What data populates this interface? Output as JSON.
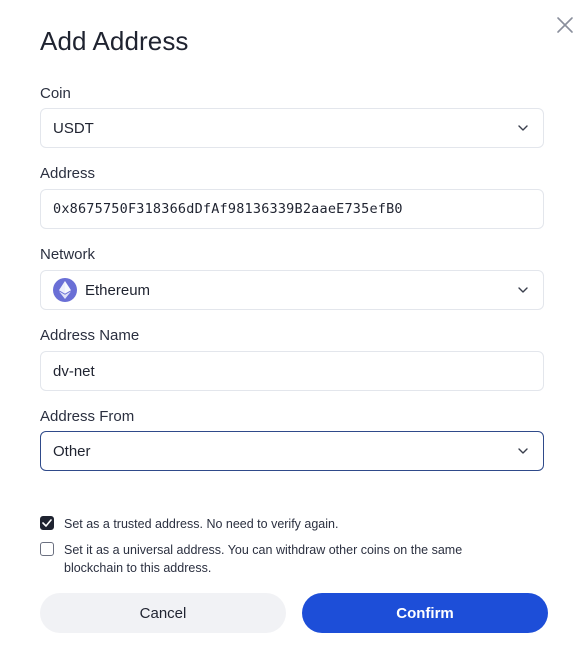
{
  "dialog": {
    "title": "Add Address",
    "close_icon": "close-icon"
  },
  "coin": {
    "label": "Coin",
    "value": "USDT"
  },
  "address": {
    "label": "Address",
    "value": "0x8675750F318366dDfAf98136339B2aaeE735efB0"
  },
  "network": {
    "label": "Network",
    "value": "Ethereum",
    "icon": "ethereum-icon"
  },
  "address_name": {
    "label": "Address Name",
    "value": "dv-net"
  },
  "address_from": {
    "label": "Address From",
    "value": "Other"
  },
  "options": {
    "trusted": {
      "label": "Set as a trusted address. No need to verify again.",
      "checked": true
    },
    "universal": {
      "label": "Set it as a universal address. You can withdraw other coins on the same blockchain to this address.",
      "checked": false
    }
  },
  "buttons": {
    "cancel": "Cancel",
    "confirm": "Confirm"
  },
  "colors": {
    "primary": "#1d4ed8",
    "focus_border": "#2f4a8a",
    "ethereum": "#6a6fd6"
  }
}
